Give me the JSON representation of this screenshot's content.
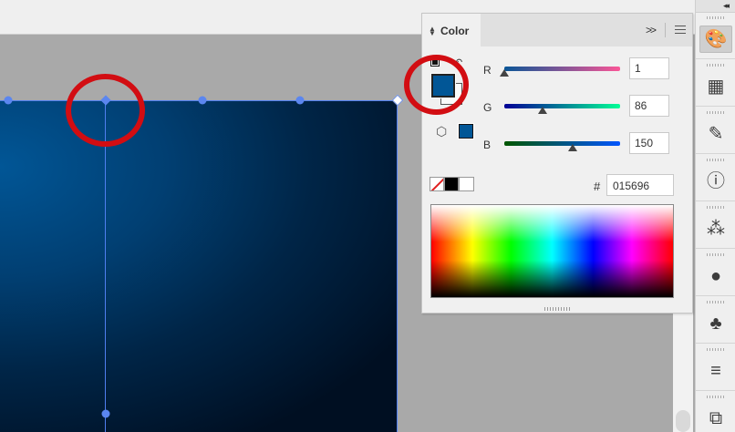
{
  "color_panel": {
    "title": "Color",
    "expand_label": ">>",
    "fill_color": "#015696",
    "channels": [
      {
        "label": "R",
        "value": "1"
      },
      {
        "label": "G",
        "value": "86"
      },
      {
        "label": "B",
        "value": "150"
      }
    ],
    "hash_label": "#",
    "hex_value": "015696"
  },
  "colors": {
    "annotation_red": "#d20d12",
    "selection_blue": "#4f7ff0"
  },
  "dock_icons": [
    "color-palette-icon",
    "swatches-icon",
    "brushes-icon",
    "document-info-icon",
    "mesh-icon",
    "appearance-icon",
    "symbols-icon",
    "align-icon",
    "transform-icon"
  ]
}
